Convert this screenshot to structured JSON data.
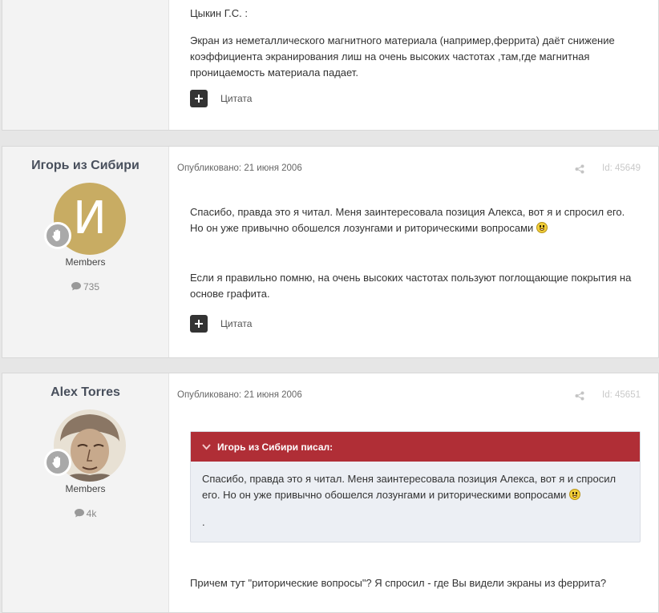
{
  "posts": [
    {
      "body": [
        "Цыкин Г.С. :",
        "Экран из неметаллического магнитного материала (например,феррита) даёт снижение коэффициента экранирования лиш на очень высоких частотах ,там,где магнитная проницаемость материала падает."
      ],
      "quote_label": "Цитата"
    },
    {
      "author": "Игорь из Сибири",
      "avatar_letter": "И",
      "group": "Members",
      "post_count": "735",
      "date": "Опубликовано: 21 июня 2006",
      "post_id": "Id: 45649",
      "body": [
        "Спасибо, правда это я читал. Меня заинтересовала позиция Алекса, вот я и спросил его. Но он уже привычно обошелся лозунгами и риторическими вопросами",
        "Если я правильно помню, на очень высоких частотах пользуют поглощающие покрытия на основе графита."
      ],
      "quote_label": "Цитата"
    },
    {
      "author": "Alex Torres",
      "group": "Members",
      "post_count": "4k",
      "date": "Опубликовано: 21 июня 2006",
      "post_id": "Id: 45651",
      "quote": {
        "header": "Игорь из Сибири писал:",
        "text": "Спасибо, правда это я читал. Меня заинтересовала позиция Алекса, вот я и спросил его. Но он уже привычно обошелся лозунгами и риторическими вопросами",
        "tail": "."
      },
      "body": [
        "Причем тут \"риторические вопросы\"? Я спросил - где Вы видели экраны из феррита?"
      ]
    }
  ],
  "colors": {
    "quote_header": "#b02e36",
    "avatar_bg": "#c8ac63",
    "author_name": "#484f5c"
  },
  "icons": [
    "share-icon",
    "comment-icon",
    "plus-icon",
    "chevron-down-icon",
    "hand-icon"
  ]
}
